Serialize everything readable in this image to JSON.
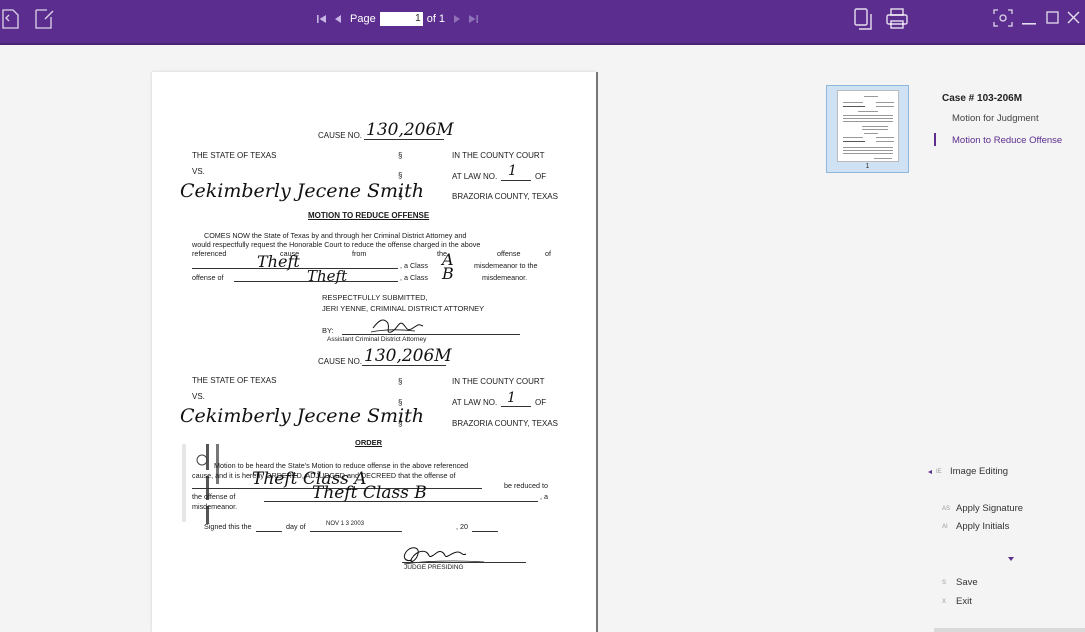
{
  "toolbar": {
    "page_label": "Page",
    "page_value": "1",
    "of_label": "of 1",
    "accent": "#5b2d8e"
  },
  "document": {
    "cause_label_1": "CAUSE NO.",
    "cause_hand_1": "130,206M",
    "state_left_1": "THE STATE OF TEXAS",
    "sec_1a": "§",
    "court_1": "IN THE COUNTY COURT",
    "vs_1": "VS.",
    "sec_1b": "§",
    "atlaw_1": "AT LAW NO.",
    "atlaw_hand_1": "1",
    "of_1": "OF",
    "defendant_hand_1": "Cekimberly Jecene Smith",
    "sec_1c": "§",
    "county_1": "BRAZORIA COUNTY, TEXAS",
    "motion_title": "MOTION TO REDUCE OFFENSE",
    "motion_p1": "COMES NOW the State of Texas by and through her Criminal District Attorney and",
    "motion_p2": "would respectfully request the Honorable Court to reduce the offense charged in the above",
    "motion_p3a": "referenced",
    "motion_p3b": "cause",
    "motion_p3c": "from",
    "motion_p3d": "the",
    "motion_p3e": "offense",
    "motion_p3f": "of",
    "motion_hand_theft_1": "Theft",
    "motion_class_a_text": ", a Class",
    "motion_class_a_hand": "A",
    "motion_class_a_tail": "misdemeanor to the",
    "motion_offense_of": "offense of",
    "motion_hand_theft_2": "Theft",
    "motion_class_b_text": ", a Class",
    "motion_class_b_hand": "B",
    "motion_class_b_tail": "misdemeanor.",
    "respectfully": "RESPECTFULLY SUBMITTED,",
    "da_name": "JERI YENNE, CRIMINAL DISTRICT ATTORNEY",
    "by_label": "BY:",
    "asst_da": "Assistant Criminal District Attorney",
    "cause_label_2": "CAUSE NO.",
    "cause_hand_2": "130,206M",
    "state_left_2": "THE STATE OF TEXAS",
    "sec_2a": "§",
    "court_2": "IN THE COUNTY COURT",
    "vs_2": "VS.",
    "sec_2b": "§",
    "atlaw_2": "AT LAW NO.",
    "atlaw_hand_2": "1",
    "of_2": "OF",
    "defendant_hand_2": "Cekimberly Jecene Smith",
    "sec_2c": "§",
    "county_2": "BRAZORIA COUNTY, TEXAS",
    "order_title": "ORDER",
    "order_p1": "Motion to be heard the State's Motion to reduce offense in the above referenced",
    "order_p2": "cause, and it is hereby ORDERED, ADJUDGED and DECREED that the offense of",
    "order_hand_1": "Theft Class A",
    "order_p2_tail": "be reduced to",
    "order_p3_head": "the offense of",
    "order_hand_2": "Theft Class B",
    "order_p3_tail": ", a",
    "order_p4": "misdemeanor.",
    "signed_label": "Signed this the",
    "day_of": "day of",
    "signed_date_stamp": "NOV 1 3 2003",
    "signed_year": ", 20",
    "judge_label": "JUDGE PRESIDING"
  },
  "thumbnail": {
    "number": "1"
  },
  "outline": {
    "title": "Case # 103-206M",
    "items": [
      {
        "label": "Motion for Judgment",
        "active": false
      },
      {
        "label": "Motion to Reduce Offense",
        "active": true
      }
    ]
  },
  "actions": {
    "image_editing": {
      "icon": "IE",
      "label": "Image Editing"
    },
    "apply_signature": {
      "icon": "AS",
      "label": "Apply Signature"
    },
    "apply_initials": {
      "icon": "AI",
      "label": "Apply Initials"
    },
    "save": {
      "icon": "S",
      "label": "Save"
    },
    "exit": {
      "icon": "X",
      "label": "Exit"
    }
  }
}
